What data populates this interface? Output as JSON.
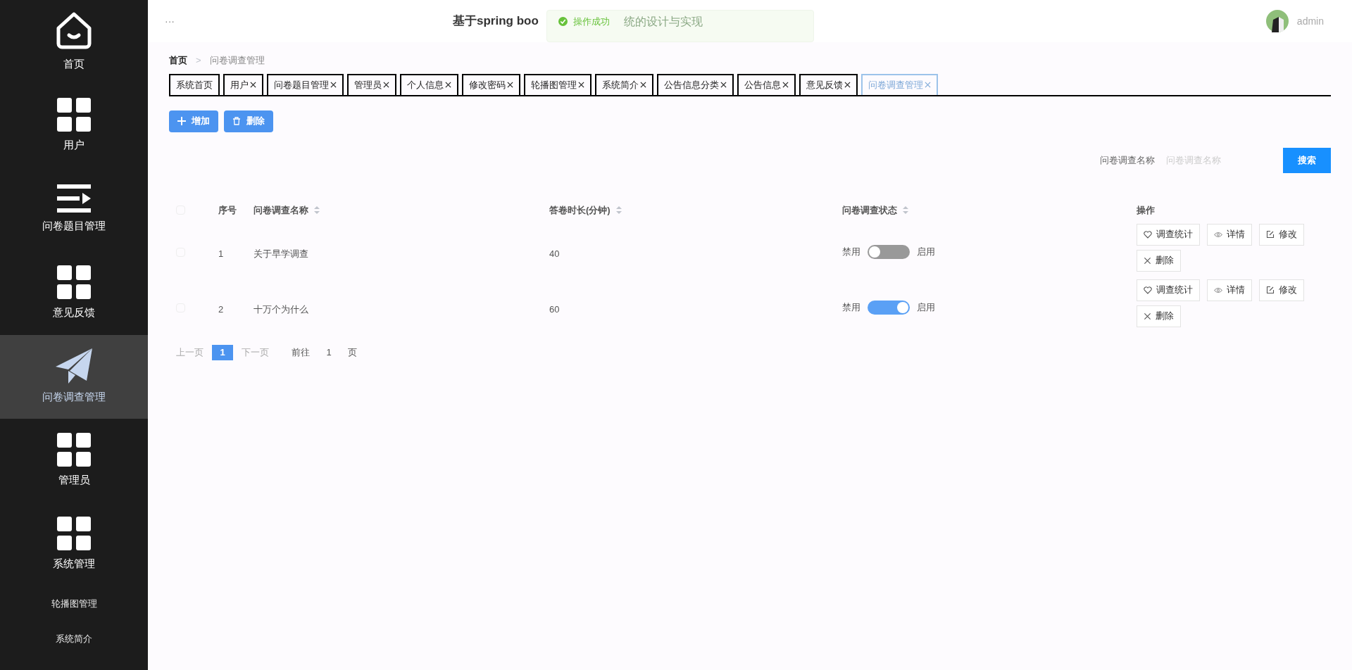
{
  "sidebar": {
    "items": [
      {
        "label": "首页",
        "kind": "home",
        "selected": false
      },
      {
        "label": "用户",
        "kind": "grid",
        "selected": false
      },
      {
        "label": "问卷题目管理",
        "kind": "list",
        "selected": false
      },
      {
        "label": "意见反馈",
        "kind": "grid",
        "selected": false
      },
      {
        "label": "问卷调查管理",
        "kind": "plane",
        "selected": true
      },
      {
        "label": "管理员",
        "kind": "grid",
        "selected": false
      },
      {
        "label": "系统管理",
        "kind": "grid",
        "selected": false
      },
      {
        "label": "轮播图管理",
        "kind": "sub",
        "selected": false
      },
      {
        "label": "系统简介",
        "kind": "sub",
        "selected": false
      }
    ]
  },
  "header": {
    "menu": "···",
    "title": "基于spring boo",
    "title_tail": "统的设计与实现",
    "toast": "操作成功",
    "user": "admin"
  },
  "breadcrumb": [
    "首页",
    "问卷调查管理"
  ],
  "breadcrumb_separator": ">",
  "tabs": [
    {
      "label": "系统首页",
      "closable": false,
      "selected": false
    },
    {
      "label": "用户",
      "closable": true,
      "selected": false
    },
    {
      "label": "问卷题目管理",
      "closable": true,
      "selected": false
    },
    {
      "label": "管理员",
      "closable": true,
      "selected": false
    },
    {
      "label": "个人信息",
      "closable": true,
      "selected": false
    },
    {
      "label": "修改密码",
      "closable": true,
      "selected": false
    },
    {
      "label": "轮播图管理",
      "closable": true,
      "selected": false
    },
    {
      "label": "系统简介",
      "closable": true,
      "selected": false
    },
    {
      "label": "公告信息分类",
      "closable": true,
      "selected": false
    },
    {
      "label": "公告信息",
      "closable": true,
      "selected": false
    },
    {
      "label": "意见反馈",
      "closable": true,
      "selected": false
    },
    {
      "label": "问卷调查管理",
      "closable": true,
      "selected": true
    }
  ],
  "toolbar": [
    {
      "label": "增加",
      "kind": "add"
    },
    {
      "label": "删除",
      "kind": "delete"
    }
  ],
  "search": {
    "label": "问卷调查名称",
    "placeholder": "问卷调查名称",
    "button": "搜索"
  },
  "table": {
    "all_checked": false,
    "columns": [
      {
        "label": "序号",
        "sortable": false
      },
      {
        "label": "问卷调查名称",
        "sortable": true
      },
      {
        "label": "答卷时长(分钟)",
        "sortable": true
      },
      {
        "label": "问卷调查状态",
        "sortable": true
      },
      {
        "label": "操作",
        "sortable": false
      }
    ],
    "rows": [
      {
        "checked": false,
        "index": "1",
        "name": "关于早学调查",
        "duration": "40",
        "off_label": "禁用",
        "on_label": "启用",
        "on": false,
        "actions": [
          {
            "label": "调查统计",
            "kind": "stats"
          },
          {
            "label": "详情",
            "kind": "view"
          },
          {
            "label": "修改",
            "kind": "edit"
          },
          {
            "label": "删除",
            "kind": "delete"
          }
        ]
      },
      {
        "checked": false,
        "index": "2",
        "name": "十万个为什么",
        "duration": "60",
        "off_label": "禁用",
        "on_label": "启用",
        "on": true,
        "actions": [
          {
            "label": "调查统计",
            "kind": "stats"
          },
          {
            "label": "详情",
            "kind": "view"
          },
          {
            "label": "修改",
            "kind": "edit"
          },
          {
            "label": "删除",
            "kind": "delete"
          }
        ]
      }
    ]
  },
  "pagination": {
    "prev": "上一页",
    "pages": [
      {
        "label": "1",
        "selected": true
      }
    ],
    "next": "下一页",
    "goto": "前往",
    "page_input": "1",
    "page_suffix": "页"
  }
}
